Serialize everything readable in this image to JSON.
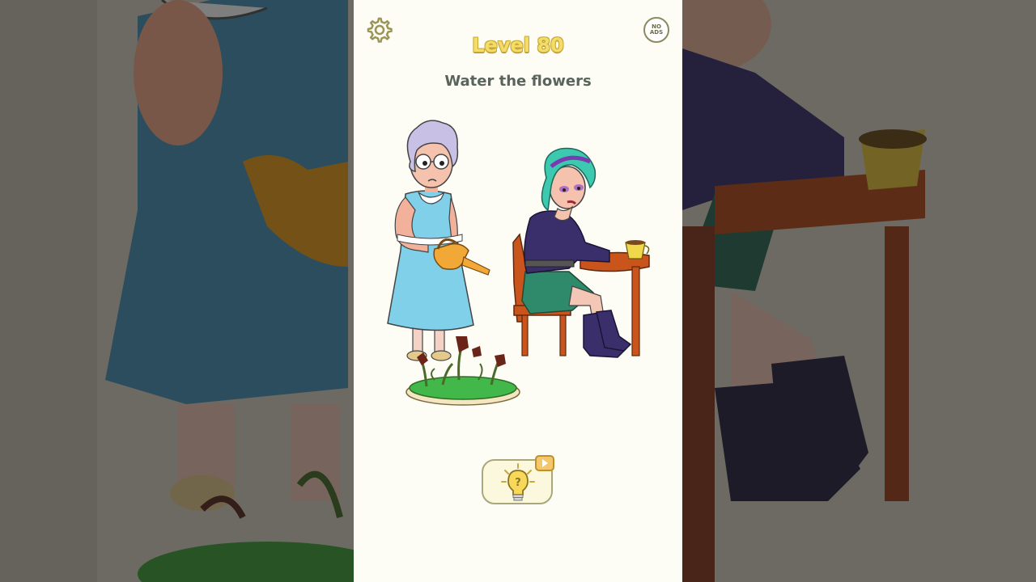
{
  "game": {
    "level_label": "Level 80",
    "task": "Water the flowers"
  },
  "toolbar": {
    "settings_icon": "gear-icon",
    "no_ads_line1": "NO",
    "no_ads_line2": "ADS"
  },
  "hint": {
    "icon": "lightbulb-question-icon",
    "badge_icon": "video-play-icon"
  },
  "colors": {
    "title_yellow": "#f3dc67",
    "task_text": "#58645c",
    "background": "#fdfdf6"
  }
}
